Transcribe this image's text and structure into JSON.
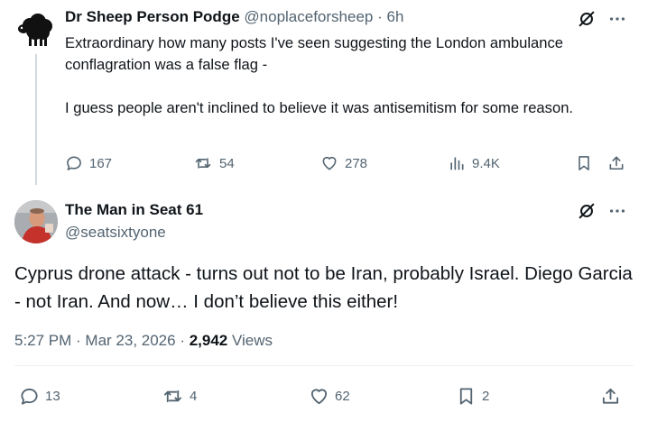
{
  "tweet1": {
    "author_name": "Dr Sheep Person Podge",
    "author_handle": "@noplaceforsheep",
    "dot": "·",
    "time": "6h",
    "paragraphs": [
      "Extraordinary how many posts I've seen suggesting the London ambulance conflagration was a false flag -",
      "I guess people aren't inclined to believe it was antisemitism for some reason."
    ],
    "replies": "167",
    "reposts": "54",
    "likes": "278",
    "views": "9.4K"
  },
  "tweet2": {
    "author_name": "The Man in Seat 61",
    "author_handle": "@seatsixtyone",
    "text": "Cyprus drone attack - turns out not to be Iran, probably Israel. Diego Garcia - not Iran. And now… I don’t believe this either!",
    "timestamp": "5:27 PM · Mar 23, 2026 · ",
    "views_count": "2,942",
    "views_label": " Views",
    "replies": "13",
    "reposts": "4",
    "likes": "62",
    "bookmarks": "2"
  },
  "icons": {
    "reply": "reply-icon",
    "repost": "repost-icon",
    "like": "heart-icon",
    "views": "views-icon",
    "bookmark": "bookmark-icon",
    "share": "share-icon",
    "grok": "grok-icon",
    "more": "more-icon"
  },
  "colors": {
    "text": "#0f1419",
    "secondary": "#536471",
    "thread_line": "#cfd9de",
    "divider": "#eff3f4"
  }
}
